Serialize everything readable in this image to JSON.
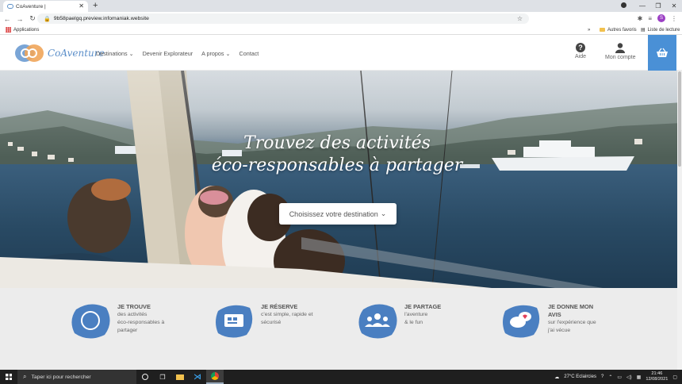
{
  "browser": {
    "tab_title": "CoAventure |",
    "new_tab": "+",
    "url": "9b58paelgq.preview.infomaniak.website",
    "bookmarks": {
      "apps": "Applications",
      "other": "Autres favoris",
      "reading": "Liste de lecture"
    },
    "profile_initial": "S"
  },
  "site": {
    "brand": "CoAventure",
    "nav": [
      {
        "label": "Destinations",
        "dropdown": true
      },
      {
        "label": "Devenir Explorateur",
        "dropdown": false
      },
      {
        "label": "A propos",
        "dropdown": true
      },
      {
        "label": "Contact",
        "dropdown": false
      }
    ],
    "help_label": "Aide",
    "account_label": "Mon compte",
    "accent": "#4a90d6"
  },
  "hero": {
    "title_line1": "Trouvez des activités",
    "title_line2": "éco-responsables à partager",
    "destination_button": "Choisissez votre destination"
  },
  "features": [
    {
      "title": "JE TROUVE",
      "lines": [
        "des activités",
        "éco-responsables à",
        "partager"
      ],
      "icon": "compass-icon"
    },
    {
      "title": "JE RÉSERVE",
      "lines": [
        "c'est simple, rapide et",
        "sécurisé"
      ],
      "icon": "cart-icon"
    },
    {
      "title": "JE PARTAGE",
      "lines": [
        "l'aventure",
        "& le fun"
      ],
      "icon": "group-icon"
    },
    {
      "title": "JE DONNE MON",
      "title2": "AVIS",
      "lines": [
        "sur l'expérience que",
        "j'ai vécue"
      ],
      "icon": "heart-chat-icon"
    }
  ],
  "taskbar": {
    "search_placeholder": "Taper ici pour rechercher",
    "weather": "27°C  Eclaircies",
    "time": "21:46",
    "date": "12/08/2021"
  }
}
